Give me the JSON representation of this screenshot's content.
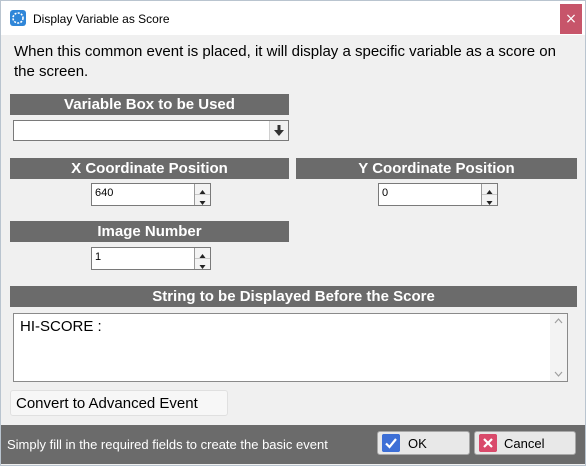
{
  "window": {
    "title": "Display Variable as Score",
    "close_glyph": "×",
    "icon": "app-gear-icon"
  },
  "description": "When this common event is placed, it will display a specific variable as a score on the screen.",
  "variable_box": {
    "header": "Variable Box to be Used",
    "value": "",
    "dropdown_icon": "arrow-down-icon"
  },
  "x_coord": {
    "header": "X Coordinate Position",
    "value": "640"
  },
  "y_coord": {
    "header": "Y Coordinate Position",
    "value": "0"
  },
  "image_number": {
    "header": "Image Number",
    "value": "1"
  },
  "prefix_string": {
    "header": "String to be Displayed Before the Score",
    "value": "HI-SCORE :"
  },
  "convert_button": {
    "label": "Convert to Advanced Event"
  },
  "status": {
    "text": "Simply fill in the required fields to create the basic event"
  },
  "ok_button": {
    "label": "OK"
  },
  "cancel_button": {
    "label": "Cancel"
  }
}
